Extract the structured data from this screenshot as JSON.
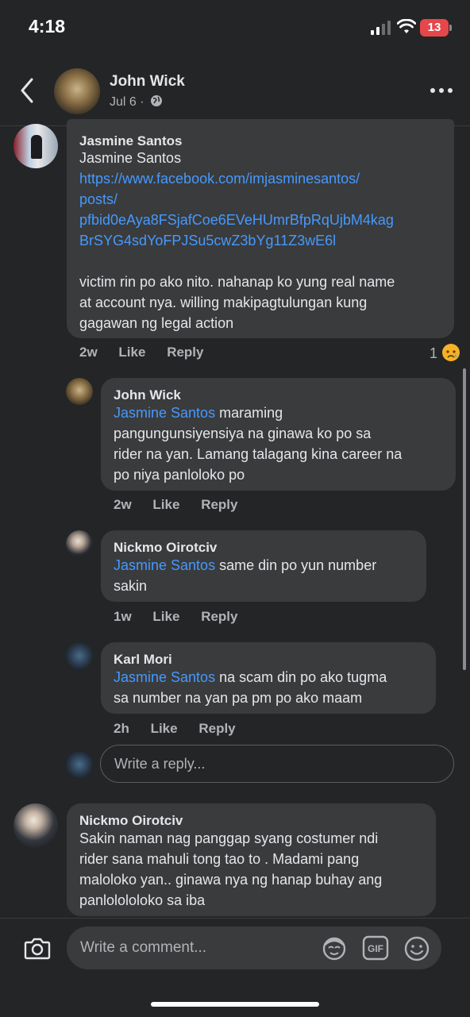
{
  "status_bar": {
    "time": "4:18",
    "battery": "13"
  },
  "header": {
    "name": "John Wick",
    "date": "Jul 6 ·"
  },
  "comments": [
    {
      "name": "Jasmine Santos",
      "line1": "Jasmine Santos",
      "link_lines": [
        "https://www.facebook.com/imjasminesantos/",
        "posts/",
        "pfbid0eAya8FSjafCoe6EVeHUmrBfpRqUjbM4kag",
        "BrSYG4sdYoFPJSu5cwZ3bYg11Z3wE6l"
      ],
      "text_lines": [
        "victim rin po ako nito. nahanap ko yung real name",
        "at account nya. willing makipagtulungan kung",
        "gagawan ng legal action"
      ],
      "time": "2w",
      "like": "Like",
      "reply": "Reply",
      "reaction_count": "1"
    },
    {
      "name": "John Wick",
      "mention": "Jasmine Santos",
      "first_line_rest": " maraming",
      "text_lines": [
        "pangungunsiyensiya na ginawa ko po sa",
        "rider na yan. Lamang talagang kina career na",
        "po niya panloloko po"
      ],
      "time": "2w",
      "like": "Like",
      "reply": "Reply"
    },
    {
      "name": "Nickmo Oirotciv",
      "mention": "Jasmine Santos",
      "first_line_rest": " same din po yun number",
      "text_lines": [
        "sakin"
      ],
      "time": "1w",
      "like": "Like",
      "reply": "Reply"
    },
    {
      "name": "Karl Mori",
      "mention": "Jasmine Santos",
      "first_line_rest": " na scam din po ako tugma",
      "text_lines": [
        "sa number na yan pa pm po ako maam"
      ],
      "time": "2h",
      "like": "Like",
      "reply": "Reply"
    },
    {
      "name": "Nickmo Oirotciv",
      "text_lines": [
        "Sakin naman nag panggap syang costumer ndi",
        "rider sana mahuli tong tao to . Madami pang",
        "maloloko yan.. ginawa nya ng hanap buhay ang",
        "panlolololoko sa iba"
      ]
    }
  ],
  "reply_placeholder": "Write a reply...",
  "comment_placeholder": "Write a comment...",
  "icons": {
    "back": "chevron-left-icon",
    "more": "more-horizontal-icon",
    "camera": "camera-icon",
    "avatar_sticker": "avatar-sticker-icon",
    "gif": "gif-icon",
    "emoji": "smiley-icon",
    "reaction": "sad-reaction-icon",
    "globe": "globe-icon"
  },
  "colors": {
    "background": "#242526",
    "bubble": "#3a3b3c",
    "mention": "#4599ff",
    "text": "#e4e6eb",
    "muted": "#b0b3b8"
  }
}
